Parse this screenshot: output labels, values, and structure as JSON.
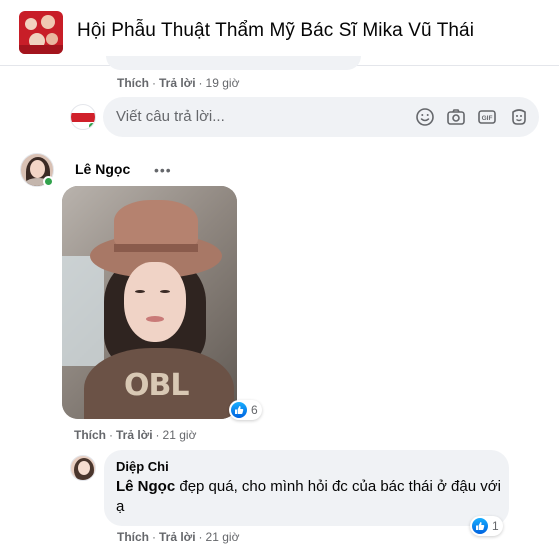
{
  "header": {
    "group_title": "Hội Phẫu Thuật Thẩm Mỹ Bác Sĩ Mika Vũ Thái",
    "avatar_icon": "group-avatar-image"
  },
  "previous_comment": {
    "actions": {
      "like": "Thích",
      "reply": "Trả lời",
      "time": "19 giờ"
    }
  },
  "reply_input": {
    "placeholder": "Viết câu trả lời...",
    "icons": [
      "emoji-icon",
      "camera-icon",
      "gif-icon",
      "sticker-icon"
    ]
  },
  "comment1": {
    "author": "Lê Ngọc",
    "more": "•••",
    "likes": "6",
    "actions": {
      "like": "Thích",
      "reply": "Trả lời",
      "time": "21 giờ"
    }
  },
  "reply1": {
    "author": "Diệp Chi",
    "mention": "Lê Ngọc",
    "text": " đẹp quá, cho mình hỏi đc của bác thái ở đậu với ạ",
    "likes": "1",
    "actions": {
      "like": "Thích",
      "reply": "Trả lời",
      "time": "21 giờ"
    }
  },
  "colors": {
    "bubble": "#f0f2f5",
    "muted_text": "#65676b",
    "like_blue": "#0062df",
    "online": "#31a24c"
  }
}
